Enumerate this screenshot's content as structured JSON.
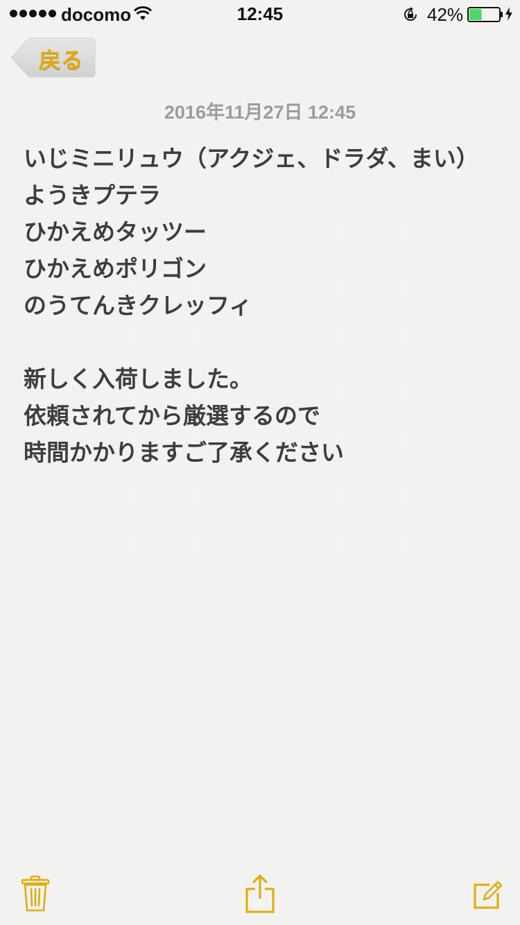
{
  "status_bar": {
    "carrier": "docomo",
    "time": "12:45",
    "battery_percent": "42%",
    "battery_level": 0.42,
    "signal_bars": 5,
    "icons": [
      "signal-dots-icon",
      "wifi-icon",
      "rotation-lock-icon",
      "battery-icon",
      "charging-bolt-icon"
    ]
  },
  "nav": {
    "back_label": "戻る"
  },
  "note": {
    "date": "2016年11月27日 12:45",
    "lines": [
      "いじミニリュウ（アクジェ、ドラダ、まい）",
      "ようきプテラ",
      "ひかえめタッツー",
      "ひかえめポリゴン",
      "のうてんきクレッフィ",
      "",
      "新しく入荷しました。",
      "依頼されてから厳選するので",
      "時間かかりますご了承ください"
    ]
  },
  "toolbar": {
    "icons": [
      "trash-icon",
      "share-icon",
      "compose-icon"
    ]
  },
  "colors": {
    "accent": "#e5a900",
    "text": "#3d3d3d",
    "date": "#9b9b9b",
    "background": "#f4f4f3",
    "battery_fill": "#4cd964"
  }
}
